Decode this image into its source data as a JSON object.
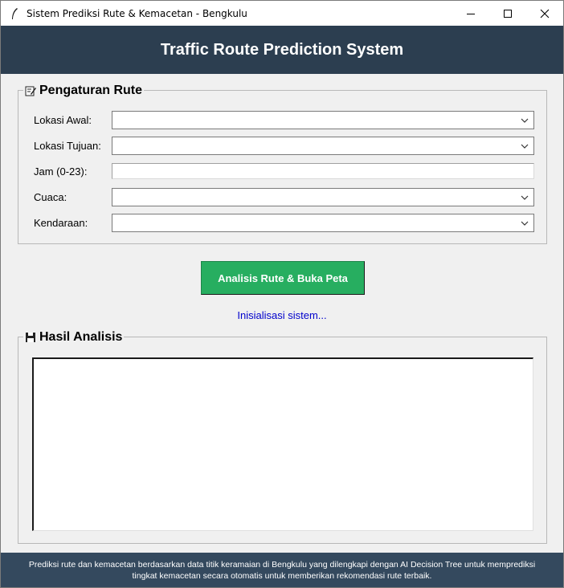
{
  "window": {
    "title": "Sistem Prediksi Rute & Kemacetan - Bengkulu",
    "controls": {
      "minimize_icon": "minimize-icon",
      "maximize_icon": "maximize-icon",
      "close_icon": "close-icon"
    }
  },
  "header": {
    "title": "Traffic Route Prediction System",
    "background": "#2c3e50"
  },
  "route_settings": {
    "legend": "Pengaturan Rute",
    "icon": "memo-icon",
    "fields": {
      "start": {
        "label": "Lokasi Awal:",
        "value": ""
      },
      "destination": {
        "label": "Lokasi Tujuan:",
        "value": ""
      },
      "hour": {
        "label": "Jam (0-23):",
        "value": ""
      },
      "weather": {
        "label": "Cuaca:",
        "value": ""
      },
      "vehicle": {
        "label": "Kendaraan:",
        "value": ""
      }
    }
  },
  "actions": {
    "analyze_label": "Analisis Rute & Buka Peta",
    "analyze_color": "#27ae60"
  },
  "status": {
    "text": "Inisialisasi sistem...",
    "color": "#0000cc"
  },
  "results": {
    "legend": "Hasil Analisis",
    "icon": "floppy-disk-icon",
    "content": ""
  },
  "footer": {
    "line1": "Prediksi rute dan kemacetan berdasarkan data titik keramaian di Bengkulu yang dilengkapi dengan AI Decision Tree untuk memprediksi",
    "line2": "tingkat kemacetan secara otomatis untuk memberikan rekomendasi rute terbaik.",
    "background": "#34495e"
  }
}
